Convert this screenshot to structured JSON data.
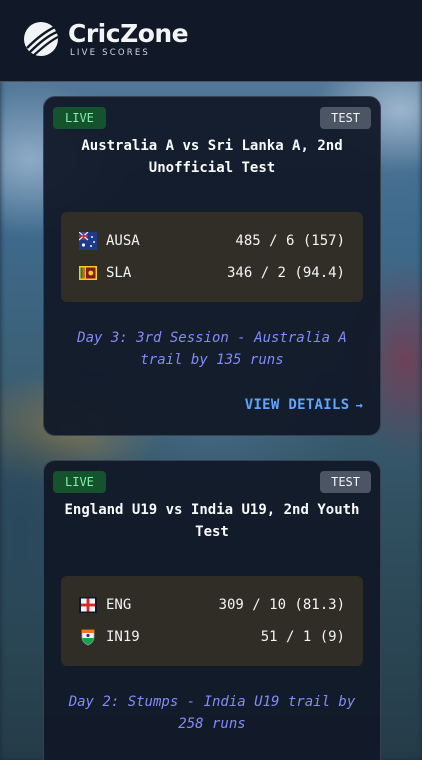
{
  "header": {
    "brand_name": "CricZone",
    "brand_tagline": "LIVE SCORES"
  },
  "matches": [
    {
      "status_badge": "LIVE",
      "format_badge": "TEST",
      "title": "Australia A vs Sri Lanka A, 2nd Unofficial Test",
      "teams": [
        {
          "code": "AUSA",
          "score": "485 / 6 (157)",
          "flag_icon": "australia-flag-icon"
        },
        {
          "code": "SLA",
          "score": "346 / 2 (94.4)",
          "flag_icon": "sri-lanka-flag-icon"
        }
      ],
      "status_text": "Day 3: 3rd Session - Australia A trail by 135 runs",
      "details_label": "VIEW DETAILS",
      "details_arrow": "→"
    },
    {
      "status_badge": "LIVE",
      "format_badge": "TEST",
      "title": "England U19 vs India U19, 2nd Youth Test",
      "teams": [
        {
          "code": "ENG",
          "score": "309 / 10 (81.3)",
          "flag_icon": "england-flag-icon"
        },
        {
          "code": "IN19",
          "score": "51 / 1 (9)",
          "flag_icon": "india-cricket-crest-icon"
        }
      ],
      "status_text": "Day 2: Stumps - India U19 trail by 258 runs"
    }
  ],
  "colors": {
    "header_bg": "#111827",
    "card_bg": "#111827",
    "live_badge_bg": "#14532d",
    "live_badge_text": "#86efac",
    "format_badge_bg": "#4b5563",
    "status_text": "#818cf8",
    "details_link": "#60a5fa"
  }
}
